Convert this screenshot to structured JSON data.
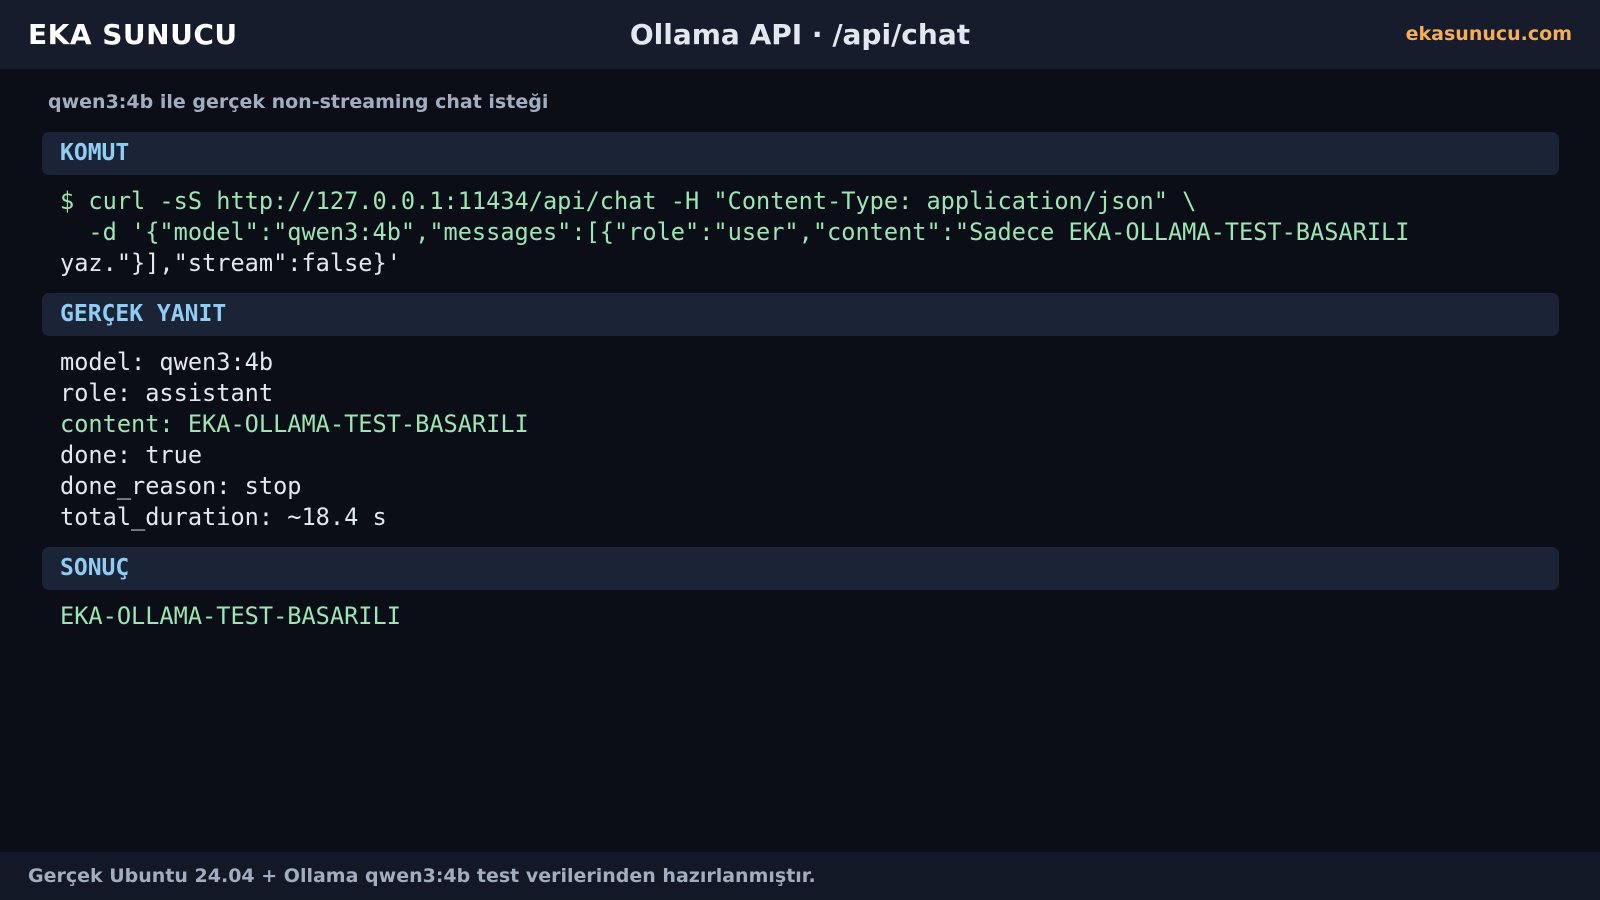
{
  "header": {
    "brand": "EKA SUNUCU",
    "title": "Ollama API · /api/chat",
    "site": "ekasunucu.com"
  },
  "subtitle": "qwen3:4b ile gerçek non-streaming chat isteği",
  "sections": {
    "command": {
      "label": "KOMUT",
      "lines": [
        "$ curl -sS http://127.0.0.1:11434/api/chat -H \"Content-Type: application/json\" \\",
        "  -d '{\"model\":\"qwen3:4b\",\"messages\":[{\"role\":\"user\",\"content\":\"Sadece EKA-OLLAMA-TEST-BASARILI",
        "yaz.\"}],\"stream\":false}'"
      ]
    },
    "response": {
      "label": "GERÇEK YANIT",
      "lines": [
        "model: qwen3:4b",
        "role: assistant",
        "content: EKA-OLLAMA-TEST-BASARILI",
        "done: true",
        "done_reason: stop",
        "total_duration: ~18.4 s"
      ]
    },
    "result": {
      "label": "SONUÇ",
      "value": "EKA-OLLAMA-TEST-BASARILI"
    }
  },
  "footer": {
    "text": "Gerçek Ubuntu 24.04 + Ollama qwen3:4b test verilerinden hazırlanmıştır."
  },
  "colors": {
    "background": "#0b0e16",
    "header_bg": "#161c2b",
    "section_bg": "#1b2436",
    "section_label": "#90cdf4",
    "code_green": "#9ae6b4",
    "code_light": "#e2e8f0",
    "accent": "#f6ad55"
  }
}
